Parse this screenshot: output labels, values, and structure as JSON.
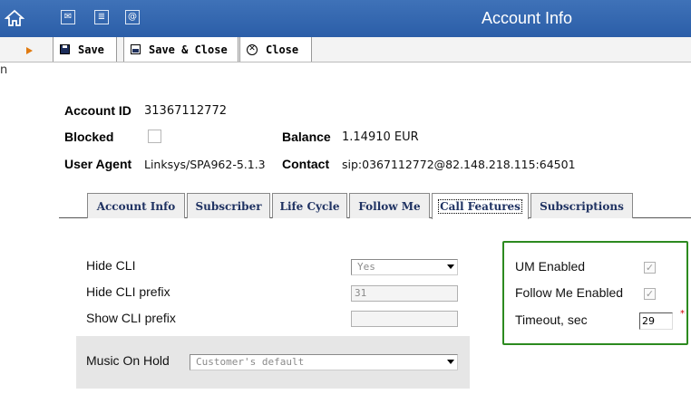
{
  "window": {
    "title": "Account Info"
  },
  "toolbar": {
    "save": "Save",
    "save_close": "Save & Close",
    "close": "Close"
  },
  "stray_text": "n",
  "header": {
    "account_id_label": "Account ID",
    "account_id_value": "31367112772",
    "blocked_label": "Blocked",
    "balance_label": "Balance",
    "balance_value": "1.14910 EUR",
    "user_agent_label": "User Agent",
    "user_agent_value": "Linksys/SPA962-5.1.3",
    "contact_label": "Contact",
    "contact_value": "sip:0367112772@82.148.218.115:64501"
  },
  "tabs": [
    {
      "label": "Account Info"
    },
    {
      "label": "Subscriber"
    },
    {
      "label": "Life Cycle"
    },
    {
      "label": "Follow Me"
    },
    {
      "label": "Call Features"
    },
    {
      "label": "Subscriptions"
    }
  ],
  "active_tab": "Call Features",
  "form": {
    "hide_cli_label": "Hide CLI",
    "hide_cli_value": "Yes",
    "hide_cli_prefix_label": "Hide CLI prefix",
    "hide_cli_prefix_value": "31",
    "show_cli_prefix_label": "Show CLI prefix",
    "show_cli_prefix_value": "",
    "moh_label": "Music On Hold",
    "moh_value": "Customer's default"
  },
  "features": {
    "um_enabled_label": "UM Enabled",
    "um_enabled_checked": true,
    "follow_me_label": "Follow Me Enabled",
    "follow_me_checked": true,
    "timeout_label": "Timeout, sec",
    "timeout_value": "29",
    "required_mark": "*"
  },
  "colors": {
    "title_bar": "#2b5ea8",
    "highlight_border": "#2c8a1f",
    "tab_text": "#1f3262"
  }
}
